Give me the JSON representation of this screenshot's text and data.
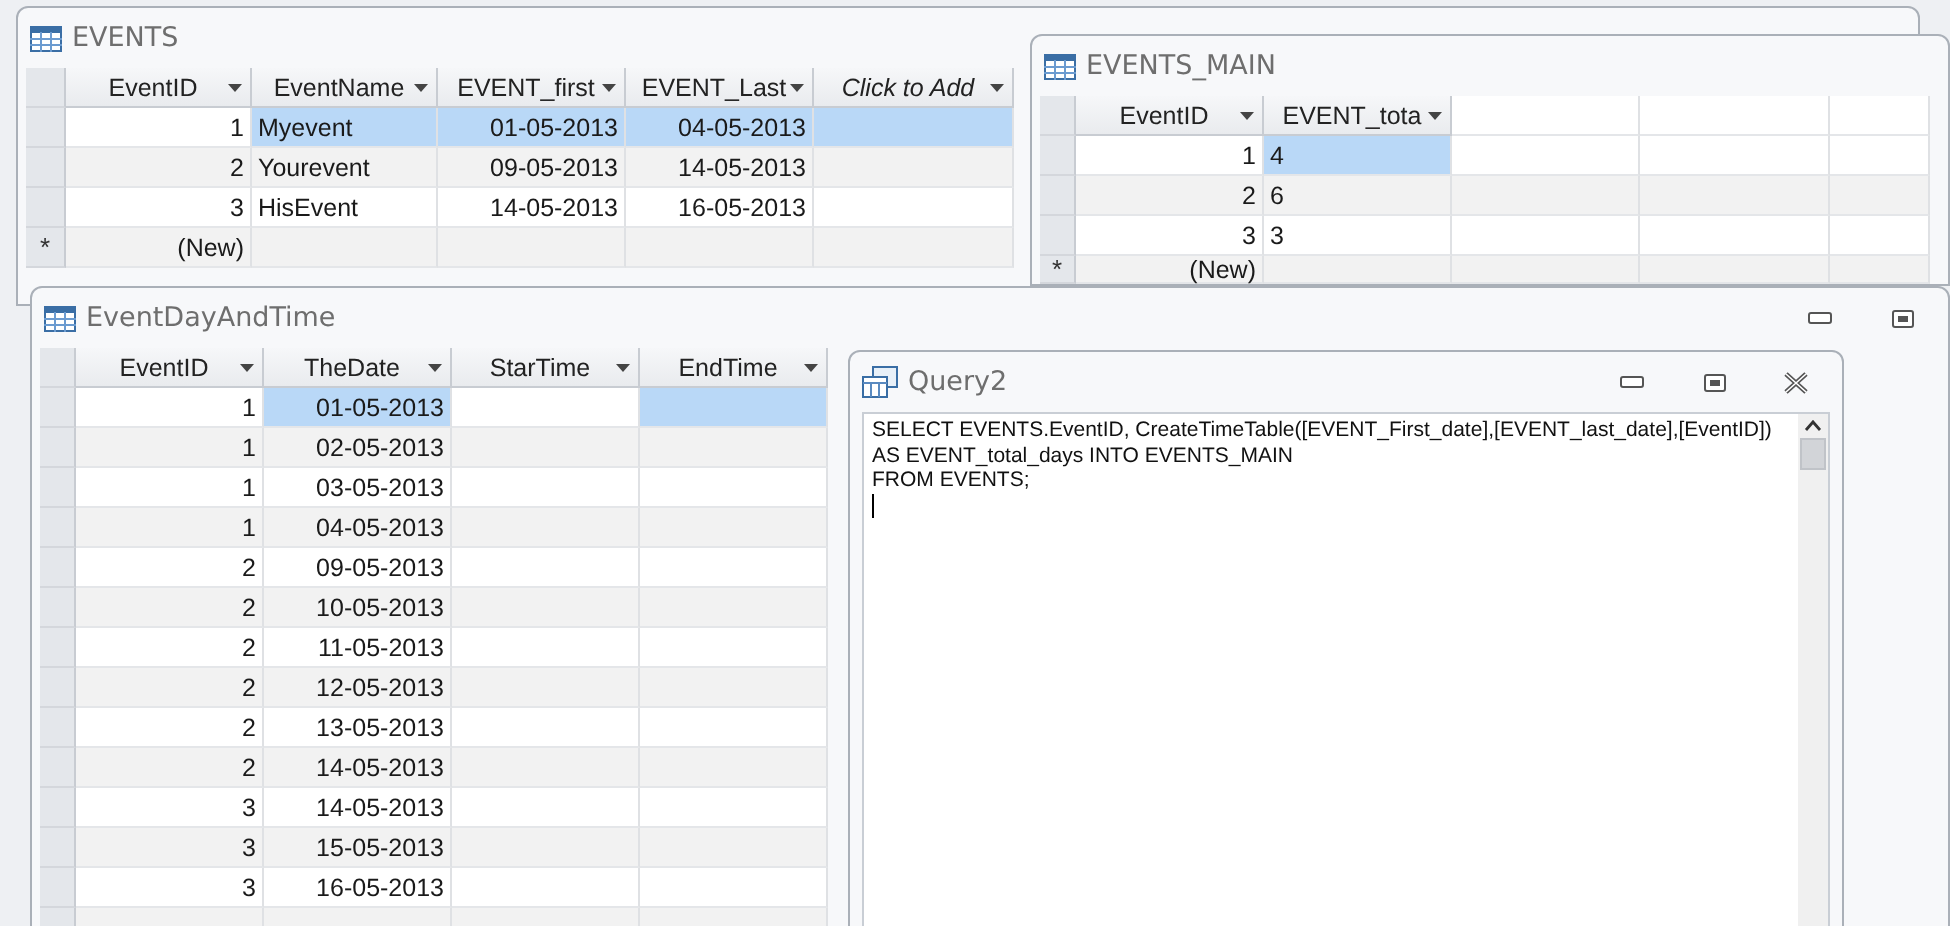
{
  "windows": [
    {
      "kind": "table",
      "title": "EVENTS",
      "columns": [
        {
          "kind": "number",
          "label": "EventID"
        },
        {
          "kind": "text",
          "label": "EventName"
        },
        {
          "kind": "date",
          "label": "EVENT_first"
        },
        {
          "kind": "date",
          "label": "EVENT_Last"
        },
        {
          "kind": "add",
          "label": "Click to Add"
        }
      ],
      "rows": [
        {
          "cells": [
            {
              "text": "1",
              "selected": false
            },
            {
              "text": "Myevent",
              "selected": true
            },
            {
              "text": "01-05-2013",
              "selected": true
            },
            {
              "text": "04-05-2013",
              "selected": true
            },
            {
              "selected": true
            }
          ]
        },
        {
          "cells": [
            {
              "text": "2",
              "selected": false
            },
            {
              "text": "Yourevent",
              "selected": false
            },
            {
              "text": "09-05-2013",
              "selected": false
            },
            {
              "text": "14-05-2013",
              "selected": false
            },
            {
              "selected": false
            }
          ]
        },
        {
          "cells": [
            {
              "text": "3",
              "selected": false
            },
            {
              "text": "HisEvent",
              "selected": false
            },
            {
              "text": "14-05-2013",
              "selected": false
            },
            {
              "text": "16-05-2013",
              "selected": false
            },
            {
              "selected": false
            }
          ]
        }
      ],
      "new_row": {
        "marker": "*",
        "label": "(New)"
      }
    },
    {
      "kind": "table",
      "title": "EVENTS_MAIN",
      "columns": [
        {
          "kind": "number",
          "label": "EventID"
        },
        {
          "kind": "text",
          "label": "EVENT_tota"
        },
        {
          "kind": "blank"
        },
        {
          "kind": "blank"
        },
        {
          "kind": "blank"
        }
      ],
      "rows": [
        {
          "cells": [
            {
              "text": "1",
              "selected": false
            },
            {
              "text": "4",
              "selected": true
            }
          ]
        },
        {
          "cells": [
            {
              "text": "2",
              "selected": false
            },
            {
              "text": "6",
              "selected": false
            }
          ]
        },
        {
          "cells": [
            {
              "text": "3",
              "selected": false
            },
            {
              "text": "3",
              "selected": false
            }
          ]
        }
      ],
      "new_row": {
        "marker": "*",
        "label": "(New)"
      }
    },
    {
      "kind": "table",
      "title": "EventDayAndTime",
      "columns": [
        {
          "kind": "number",
          "label": "EventID"
        },
        {
          "kind": "date",
          "label": "TheDate"
        },
        {
          "kind": "time",
          "label": "StarTime"
        },
        {
          "kind": "time",
          "label": "EndTime"
        }
      ],
      "rows": [
        {
          "cells": [
            {
              "text": "1",
              "selected": false
            },
            {
              "text": "01-05-2013",
              "selected": true
            },
            {
              "selected": false
            },
            {
              "selected": true
            }
          ]
        },
        {
          "cells": [
            {
              "text": "1",
              "selected": false
            },
            {
              "text": "02-05-2013",
              "selected": false
            },
            {
              "selected": false
            },
            {
              "selected": false
            }
          ]
        },
        {
          "cells": [
            {
              "text": "1",
              "selected": false
            },
            {
              "text": "03-05-2013",
              "selected": false
            },
            {
              "selected": false
            },
            {
              "selected": false
            }
          ]
        },
        {
          "cells": [
            {
              "text": "1",
              "selected": false
            },
            {
              "text": "04-05-2013",
              "selected": false
            },
            {
              "selected": false
            },
            {
              "selected": false
            }
          ]
        },
        {
          "cells": [
            {
              "text": "2",
              "selected": false
            },
            {
              "text": "09-05-2013",
              "selected": false
            },
            {
              "selected": false
            },
            {
              "selected": false
            }
          ]
        },
        {
          "cells": [
            {
              "text": "2",
              "selected": false
            },
            {
              "text": "10-05-2013",
              "selected": false
            },
            {
              "selected": false
            },
            {
              "selected": false
            }
          ]
        },
        {
          "cells": [
            {
              "text": "2",
              "selected": false
            },
            {
              "text": "11-05-2013",
              "selected": false
            },
            {
              "selected": false
            },
            {
              "selected": false
            }
          ]
        },
        {
          "cells": [
            {
              "text": "2",
              "selected": false
            },
            {
              "text": "12-05-2013",
              "selected": false
            },
            {
              "selected": false
            },
            {
              "selected": false
            }
          ]
        },
        {
          "cells": [
            {
              "text": "2",
              "selected": false
            },
            {
              "text": "13-05-2013",
              "selected": false
            },
            {
              "selected": false
            },
            {
              "selected": false
            }
          ]
        },
        {
          "cells": [
            {
              "text": "2",
              "selected": false
            },
            {
              "text": "14-05-2013",
              "selected": false
            },
            {
              "selected": false
            },
            {
              "selected": false
            }
          ]
        },
        {
          "cells": [
            {
              "text": "3",
              "selected": false
            },
            {
              "text": "14-05-2013",
              "selected": false
            },
            {
              "selected": false
            },
            {
              "selected": false
            }
          ]
        },
        {
          "cells": [
            {
              "text": "3",
              "selected": false
            },
            {
              "text": "15-05-2013",
              "selected": false
            },
            {
              "selected": false
            },
            {
              "selected": false
            }
          ]
        },
        {
          "cells": [
            {
              "text": "3",
              "selected": false
            },
            {
              "text": "16-05-2013",
              "selected": false
            },
            {
              "selected": false
            },
            {
              "selected": false
            }
          ]
        }
      ],
      "window_buttons": [
        {
          "kind": "minimize"
        },
        {
          "kind": "restore"
        }
      ]
    },
    {
      "kind": "query",
      "title": "Query2",
      "sql": "SELECT EVENTS.EventID, CreateTimeTable([EVENT_First_date],[EVENT_last_date],[EventID])\nAS EVENT_total_days INTO EVENTS_MAIN\nFROM EVENTS;",
      "window_buttons": [
        {
          "kind": "minimize"
        },
        {
          "kind": "restore"
        },
        {
          "kind": "close"
        }
      ]
    }
  ]
}
